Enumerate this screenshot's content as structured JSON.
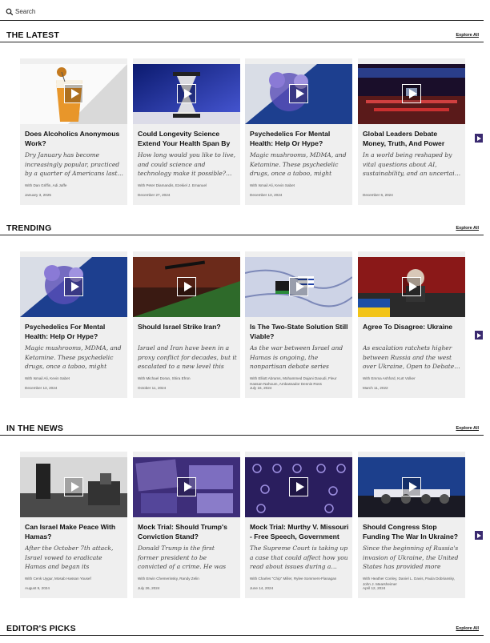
{
  "search": {
    "placeholder": "Search"
  },
  "explore_label": "Explore All",
  "sections": [
    {
      "title": "THE LATEST",
      "cards": [
        {
          "title": "Does Alcoholics Anonymous Work?",
          "desc": "Dry January has become increasingly popular, practiced by a quarter of Americans last…",
          "authors": "With Dan Griffin, Adi Jaffe",
          "date": "January 3, 2025"
        },
        {
          "title": "Could Longevity Science Extend Your Health Span By Decades?…",
          "desc": "How long would you like to live, and could science and technology make it possible?…",
          "authors": "With Peter Diamandis, Ezekiel J. Emanuel",
          "date": "December 27, 2024"
        },
        {
          "title": "Psychedelics For Mental Health: Help Or Hype?",
          "desc": "Magic mushrooms, MDMA, and Ketamine. These psychedelic drugs, once a taboo, might not…",
          "authors": "With Ismail Ali, Kevin Sabet",
          "date": "December 13, 2024"
        },
        {
          "title": "Global Leaders Debate Money, Truth, And Power",
          "desc": "In a world being reshaped by vital questions about AI, sustainability, and an uncertai…",
          "authors": "",
          "date": "December 6, 2024"
        }
      ]
    },
    {
      "title": "TRENDING",
      "cards": [
        {
          "title": "Psychedelics For Mental Health: Help Or Hype?",
          "desc": "Magic mushrooms, MDMA, and Ketamine. These psychedelic drugs, once a taboo, might not…",
          "authors": "With Ismail Ali, Kevin Sabet",
          "date": "December 13, 2024"
        },
        {
          "title": "Should Israel Strike Iran?",
          "desc": "Israel and Iran have been in a proxy conflict for decades, but it escalated to a new level this ye…",
          "authors": "With Michael Doran, Shira Efron",
          "date": "October 11, 2024"
        },
        {
          "title": "Is The Two-State Solution Still Viable?",
          "desc": "As the war between Israel and Hamas is ongoing, the nonpartisan debate series Ope…",
          "authors": "With Elliott Abrams, Mohammed Dajani Daoudi, Fleur Hassan-Nahoum, Ambassador Dennis Ross",
          "date": "July 16, 2024"
        },
        {
          "title": "Agree To Disagree: Ukraine",
          "desc": "As escalation ratchets higher between Russia and the west over Ukraine, Open to Debate…",
          "authors": "With Emma Ashford, Kurt Volker",
          "date": "March 11, 2022"
        }
      ]
    },
    {
      "title": "IN THE NEWS",
      "cards": [
        {
          "title": "Can Israel Make Peace With Hamas?",
          "desc": "After the October 7th attack, Israel vowed to eradicate Hamas and began its counteroperation…",
          "authors": "With Cenk Uygur, Mosab Hassan Yousef",
          "date": "August 9, 2024"
        },
        {
          "title": "Mock Trial: Should Trump's Conviction Stand?",
          "desc": "Donald Trump is the first former president to be convicted of a crime. He was found guilty of 3…",
          "authors": "With Erwin Chemerinsky, Randy Zelin",
          "date": "July 26, 2024"
        },
        {
          "title": "Mock Trial: Murthy V. Missouri - Free Speech, Government And…",
          "desc": "The Supreme Court is taking up a case that could affect how you read about issues during a…",
          "authors": "With Charles \"Chip\" Miller, Rylee Sommers-Flanagan",
          "date": "June 14, 2024"
        },
        {
          "title": "Should Congress Stop Funding The War In Ukraine?",
          "desc": "Since the beginning of Russia's invasion of Ukraine, the United States has provided more than…",
          "authors": "With Heather Conley, Daniel L. Davis, Paula Dobriansky, John J. Mearsheimer",
          "date": "April 12, 2024"
        }
      ]
    },
    {
      "title": "EDITOR'S PICKS",
      "cards": []
    }
  ]
}
